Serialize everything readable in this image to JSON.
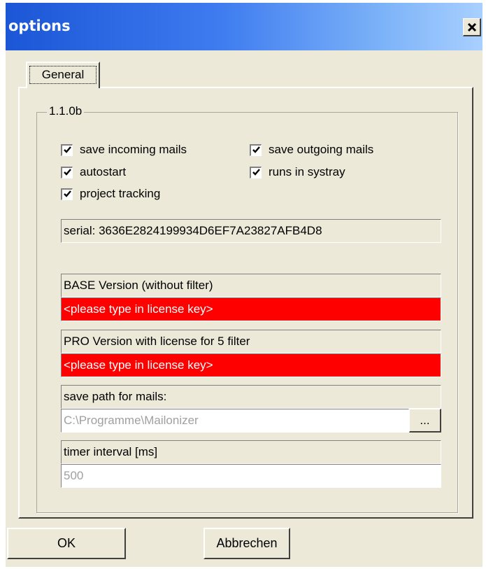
{
  "window": {
    "title": "options",
    "close_glyph": "×"
  },
  "tabs": [
    {
      "label": "General"
    }
  ],
  "group": {
    "title": "1.1.0b"
  },
  "checkboxes": {
    "save_incoming": {
      "label": "save incoming mails",
      "checked": true
    },
    "save_outgoing": {
      "label": "save outgoing mails",
      "checked": true
    },
    "autostart": {
      "label": "autostart",
      "checked": true
    },
    "systray": {
      "label": "runs in systray",
      "checked": true
    },
    "project_tracking": {
      "label": "project tracking",
      "checked": true
    }
  },
  "serial": {
    "text": "serial: 3636E2824199934D6EF7A23827AFB4D8"
  },
  "base_version": {
    "label": "BASE Version (without filter)",
    "value": "<please type in license key>"
  },
  "pro_version": {
    "label": "PRO Version with license for 5 filter",
    "value": "<please type in license key>"
  },
  "save_path": {
    "label": "save path for mails:",
    "value": "C:\\Programme\\Mailonizer",
    "browse_label": "..."
  },
  "timer": {
    "label": "timer interval [ms]",
    "value": "500"
  },
  "buttons": {
    "ok": "OK",
    "cancel": "Abbrechen"
  },
  "colors": {
    "license_invalid": "#ff0000",
    "title_gradient_start": "#1b56d6",
    "title_gradient_end": "#a9d0ff"
  }
}
